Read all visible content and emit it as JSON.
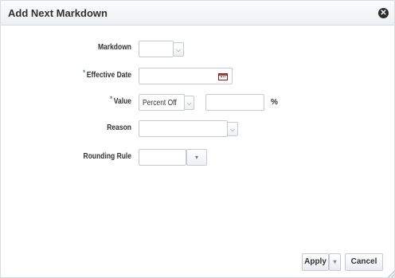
{
  "dialog": {
    "title": "Add Next Markdown",
    "close_icon": "close-circle-icon"
  },
  "form": {
    "markdown": {
      "label": "Markdown",
      "value": ""
    },
    "effective_date": {
      "label": "Effective Date",
      "required_marker": "*",
      "value": "",
      "icon": "calendar-icon"
    },
    "value": {
      "label": "Value",
      "required_marker": "*",
      "type_selected": "Percent Off",
      "amount": "",
      "unit": "%"
    },
    "reason": {
      "label": "Reason",
      "value": ""
    },
    "rounding_rule": {
      "label": "Rounding Rule",
      "value": ""
    }
  },
  "footer": {
    "apply_label": "Apply",
    "cancel_label": "Cancel"
  },
  "icons": {
    "dropdown_chevron": "chevron-down-icon",
    "dropdown_triangle": "triangle-down-icon",
    "resize": "resize-grip-icon"
  }
}
